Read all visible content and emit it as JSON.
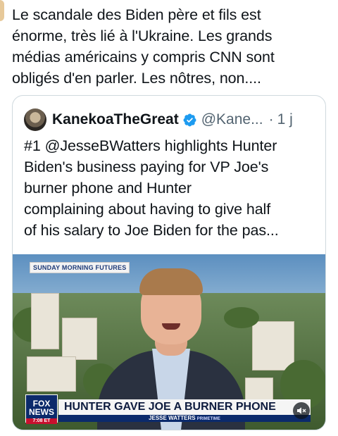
{
  "tweet": {
    "text_lines": [
      "Le scandale des Biden père et fils est",
      "énorme, très lié à l'Ukraine. Les grands",
      "médias américains y compris CNN sont",
      "obligés d'en parler. Les nôtres, non...."
    ]
  },
  "quote": {
    "display_name": "KanekoaTheGreat",
    "handle": "@Kane...",
    "separator": "·",
    "time": "1 j",
    "text_lines": [
      "#1 @JesseBWatters highlights Hunter",
      "Biden's business paying for VP Joe's",
      "burner phone and Hunter",
      "complaining about having to give half",
      "of his salary to Joe Biden for the pas..."
    ],
    "verified_icon": "verified-badge-icon",
    "verified_color": "#1d9bf0"
  },
  "video": {
    "program_tag": "SUNDAY MORNING FUTURES",
    "logo_top": "FOX",
    "logo_bottom": "NEWS",
    "logo_time": "7:08 ET",
    "headline": "HUNTER GAVE JOE A BURNER PHONE",
    "subline": "JESSE WATTERS",
    "subline_tag": "PRIMETIME",
    "mute_icon": "speaker-muted-icon"
  }
}
